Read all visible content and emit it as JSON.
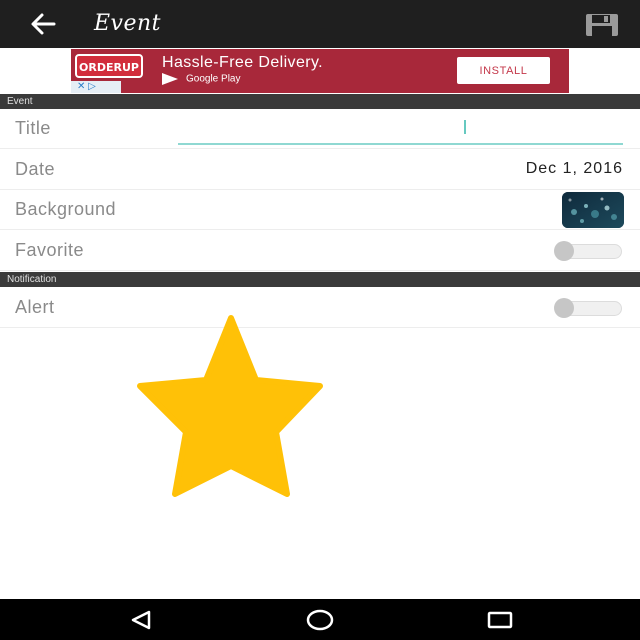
{
  "appbar": {
    "title": "Event",
    "back_icon": "arrow-back-icon",
    "save_icon": "floppy-save-icon"
  },
  "ad": {
    "brand": "ORDERUP",
    "headline": "Hassle-Free Delivery.",
    "store": "Google Play",
    "install_label": "INSTALL",
    "adchoices": "✕ ▷",
    "colors": {
      "background": "#a8283a",
      "button_text": "#c4384a"
    }
  },
  "sections": {
    "event": "Event",
    "notification": "Notification"
  },
  "rows": {
    "title": {
      "label": "Title",
      "value": ""
    },
    "date": {
      "label": "Date",
      "value": "Dec 1, 2016"
    },
    "background": {
      "label": "Background"
    },
    "favorite": {
      "label": "Favorite",
      "on": false
    },
    "alert": {
      "label": "Alert",
      "on": false
    }
  },
  "overlay": {
    "icon": "star-icon",
    "color": "#ffc107"
  },
  "navbar": {
    "back_icon": "nav-back-icon",
    "home_icon": "nav-home-icon",
    "recents_icon": "nav-recents-icon"
  }
}
